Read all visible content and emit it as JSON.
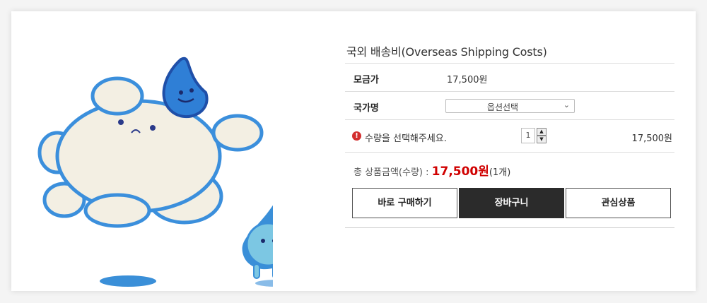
{
  "product": {
    "title": "국외 배송비(Overseas Shipping Costs)",
    "price_label": "모금가",
    "price_value": "17,500원",
    "country_label": "국가명",
    "country_select": "옵션선택",
    "qty_message": "수량을 선택해주세요.",
    "qty_value": "1",
    "row_price": "17,500원",
    "total_label": "총 상품금액(수량) :",
    "total_amount": "17,500원",
    "total_count": "(1개)"
  },
  "buttons": {
    "buy_now": "바로 구매하기",
    "cart": "장바구니",
    "wishlist": "관심상품"
  },
  "colors": {
    "accent_red": "#d00000",
    "dark_button": "#2b2b2b",
    "mascot_blue": "#2f7fd6",
    "mascot_light_blue": "#7cc7e3"
  }
}
